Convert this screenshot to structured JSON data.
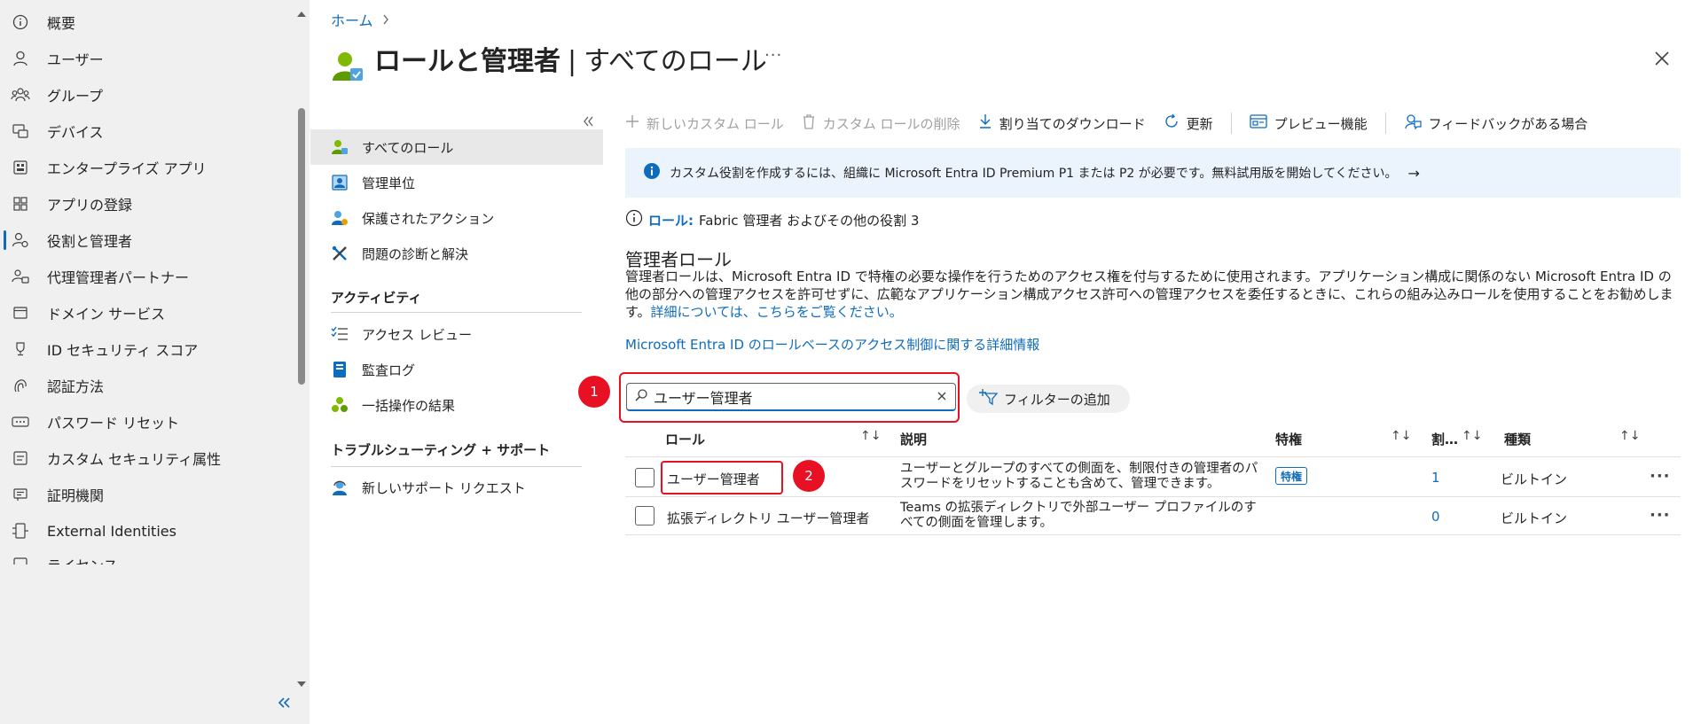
{
  "leftnav": {
    "items": [
      {
        "label": "概要",
        "icon": "info-icon"
      },
      {
        "label": "ユーザー",
        "icon": "person-icon"
      },
      {
        "label": "グループ",
        "icon": "group-icon"
      },
      {
        "label": "デバイス",
        "icon": "devices-icon"
      },
      {
        "label": "エンタープライズ アプリ",
        "icon": "enterprise-app-icon"
      },
      {
        "label": "アプリの登録",
        "icon": "app-registration-icon"
      },
      {
        "label": "役割と管理者",
        "icon": "roles-icon",
        "active": true
      },
      {
        "label": "代理管理者パートナー",
        "icon": "partner-icon"
      },
      {
        "label": "ドメイン サービス",
        "icon": "domain-icon"
      },
      {
        "label": "ID セキュリティ スコア",
        "icon": "trophy-icon"
      },
      {
        "label": "認証方法",
        "icon": "auth-method-icon"
      },
      {
        "label": "パスワード リセット",
        "icon": "password-icon"
      },
      {
        "label": "カスタム セキュリティ属性",
        "icon": "custom-attr-icon"
      },
      {
        "label": "証明機関",
        "icon": "certificate-icon"
      },
      {
        "label": "External Identities",
        "icon": "external-identities-icon"
      },
      {
        "label": "ライセンス",
        "icon": "license-icon"
      }
    ]
  },
  "header": {
    "breadcrumb_home": "ホーム",
    "title": "ロールと管理者",
    "title_sep": "|",
    "subtitle": "すべてのロール",
    "more": "···"
  },
  "blade": {
    "items": [
      {
        "label": "すべてのロール",
        "icon": "all-roles-icon",
        "selected": true
      },
      {
        "label": "管理単位",
        "icon": "admin-units-icon"
      },
      {
        "label": "保護されたアクション",
        "icon": "protected-actions-icon"
      },
      {
        "label": "問題の診断と解決",
        "icon": "diagnose-icon"
      }
    ],
    "section_activity": "アクティビティ",
    "activity_items": [
      {
        "label": "アクセス レビュー",
        "icon": "access-review-icon"
      },
      {
        "label": "監査ログ",
        "icon": "audit-log-icon"
      },
      {
        "label": "一括操作の結果",
        "icon": "bulk-results-icon"
      }
    ],
    "section_support": "トラブルシューティング + サポート",
    "support_items": [
      {
        "label": "新しいサポート リクエスト",
        "icon": "support-request-icon"
      }
    ]
  },
  "toolbar": {
    "new_custom_role": "新しいカスタム ロール",
    "delete_custom_role": "カスタム ロールの削除",
    "download_assignments": "割り当てのダウンロード",
    "refresh": "更新",
    "preview_features": "プレビュー機能",
    "feedback": "フィードバックがある場合"
  },
  "banner": {
    "text": "カスタム役割を作成するには、組織に Microsoft Entra ID Premium P1 または P2 が必要です。無料試用版を開始してください。",
    "arrow": "→"
  },
  "role_info": {
    "label": "ロール:",
    "value": "Fabric 管理者 およびその他の役割 3"
  },
  "admin_roles": {
    "heading": "管理者ロール",
    "description": "管理者ロールは、Microsoft Entra ID で特権の必要な操作を行うためのアクセス権を付与するために使用されます。アプリケーション構成に関係のない Microsoft Entra ID の他の部分への管理アクセスを許可せずに、広範なアプリケーション構成アクセス許可への管理アクセスを委任するときに、これらの組み込みロールを使用することをお勧めします。",
    "learn_more": "詳細については、こちらをご覧ください。",
    "rbac_link": "Microsoft Entra ID のロールベースのアクセス制御に関する詳細情報"
  },
  "search": {
    "value": "ユーザー管理者",
    "filter_button": "フィルターの追加"
  },
  "annotations": {
    "step1": "1",
    "step2": "2"
  },
  "table": {
    "headers": {
      "role": "ロール",
      "description": "説明",
      "privileged": "特権",
      "assignments": "割…",
      "type": "種類"
    },
    "sort_icon": "↑↓",
    "rows": [
      {
        "role": "ユーザー管理者",
        "description": "ユーザーとグループのすべての側面を、制限付きの管理者のパスワードをリセットすることも含めて、管理できます。",
        "privileged": "特権",
        "assignments": "1",
        "type": "ビルトイン",
        "more": "···"
      },
      {
        "role": "拡張ディレクトリ ユーザー管理者",
        "description": "Teams の拡張ディレクトリで外部ユーザー プロファイルのすべての側面を管理します。",
        "privileged": "",
        "assignments": "0",
        "type": "ビルトイン",
        "more": "···"
      }
    ]
  },
  "colors": {
    "accent": "#0f6cbd",
    "highlight": "#e81123",
    "nav_bg": "#f0f0f0",
    "banner_bg": "#ebf3fc"
  }
}
